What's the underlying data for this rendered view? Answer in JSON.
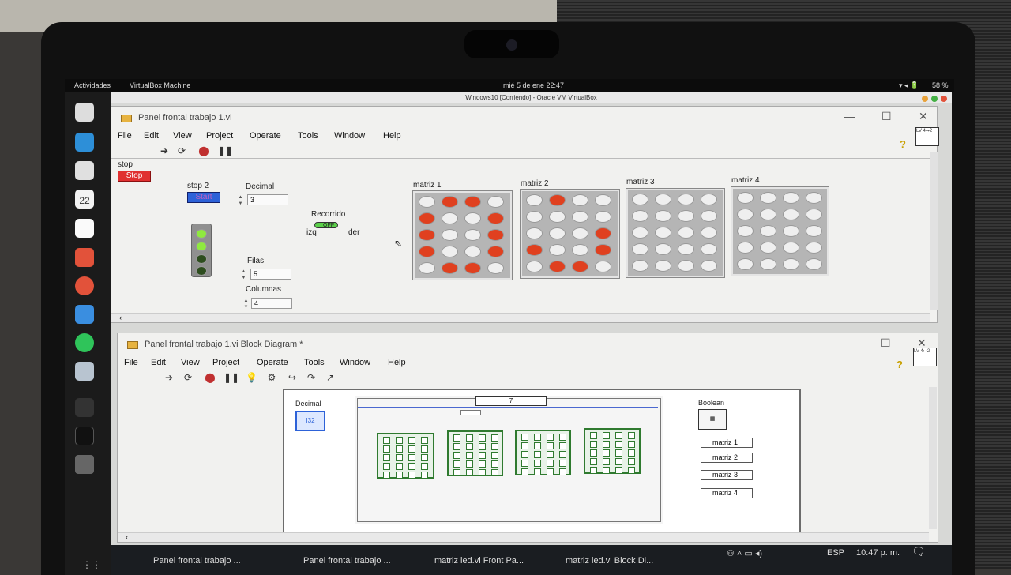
{
  "gnome": {
    "activities": "Actividades",
    "app": "VirtualBox Machine",
    "clock": "mié 5 de ene  22:47",
    "battery": "58 %"
  },
  "vbox": {
    "title": "Windows10 [Corriendo] - Oracle VM VirtualBox"
  },
  "front": {
    "title": "Panel frontal trabajo 1.vi",
    "menu": [
      "File",
      "Edit",
      "View",
      "Project",
      "Operate",
      "Tools",
      "Window",
      "Help"
    ],
    "stop_label": "stop",
    "stop_button": "Stop",
    "stop2_label": "stop 2",
    "stop2_button": "Start",
    "decimal_label": "Decimal",
    "decimal_value": "3",
    "recorrido_label": "Recorrido",
    "switch_state": "OFF",
    "izq": "izq",
    "der": "der",
    "filas_label": "Filas",
    "filas_value": "5",
    "columnas_label": "Columnas",
    "columnas_value": "4",
    "matrices": [
      {
        "label": "matriz 1",
        "leds": [
          [
            0,
            1,
            1,
            0
          ],
          [
            1,
            0,
            0,
            1
          ],
          [
            1,
            0,
            0,
            1
          ],
          [
            1,
            0,
            0,
            1
          ],
          [
            0,
            1,
            1,
            0
          ]
        ]
      },
      {
        "label": "matriz 2",
        "leds": [
          [
            0,
            1,
            0,
            0
          ],
          [
            0,
            0,
            0,
            0
          ],
          [
            0,
            0,
            0,
            1
          ],
          [
            1,
            0,
            0,
            1
          ],
          [
            0,
            1,
            1,
            0
          ]
        ]
      },
      {
        "label": "matriz 3",
        "leds": [
          [
            0,
            0,
            0,
            0
          ],
          [
            0,
            0,
            0,
            0
          ],
          [
            0,
            0,
            0,
            0
          ],
          [
            0,
            0,
            0,
            0
          ],
          [
            0,
            0,
            0,
            0
          ]
        ]
      },
      {
        "label": "matriz 4",
        "leds": [
          [
            0,
            0,
            0,
            0
          ],
          [
            0,
            0,
            0,
            0
          ],
          [
            0,
            0,
            0,
            0
          ],
          [
            0,
            0,
            0,
            0
          ],
          [
            0,
            0,
            0,
            0
          ]
        ]
      }
    ],
    "colors": {
      "led_on": "#e0401f",
      "led_off": "#efefef",
      "stop_red": "#e03030",
      "start_blue": "#2d62d8"
    }
  },
  "block": {
    "title": "Panel frontal trabajo 1.vi Block Diagram *",
    "menu": [
      "File",
      "Edit",
      "View",
      "Project",
      "Operate",
      "Tools",
      "Window",
      "Help"
    ],
    "decimal_label": "Decimal",
    "decimal_term": "I32",
    "case_value": "7",
    "boolean_label": "Boolean",
    "indicators": [
      "matriz 1",
      "matriz 2",
      "matriz 3",
      "matriz 4"
    ]
  },
  "taskbar": {
    "items": [
      "Panel frontal trabajo ...",
      "Panel frontal trabajo ...",
      "matriz led.vi Front Pa...",
      "matriz led.vi Block Di..."
    ],
    "lang": "ESP",
    "time": "10:47 p. m."
  }
}
